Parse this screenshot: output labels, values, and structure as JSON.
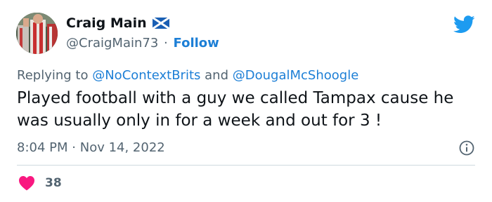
{
  "user": {
    "display_name": "Craig Main",
    "handle": "@CraigMain73",
    "separator": "·",
    "follow_label": "Follow",
    "avatar_icon": "profile-photo",
    "flag_icon": "scotland-flag-icon"
  },
  "reply": {
    "prefix": "Replying to",
    "mention_1": "@NoContextBrits",
    "conjunction": "and",
    "mention_2": "@DougalMcShoogle"
  },
  "tweet": {
    "text": "Played football with a guy we called Tampax cause he was usually only in for a week and out for 3 !"
  },
  "meta": {
    "time": "8:04 PM",
    "separator": "·",
    "date": "Nov 14, 2022"
  },
  "engagement": {
    "likes": "38"
  },
  "colors": {
    "link": "#1d7fd6",
    "twitter_blue": "#1d9bf0",
    "heart": "#f91880",
    "secondary_text": "#536471"
  }
}
